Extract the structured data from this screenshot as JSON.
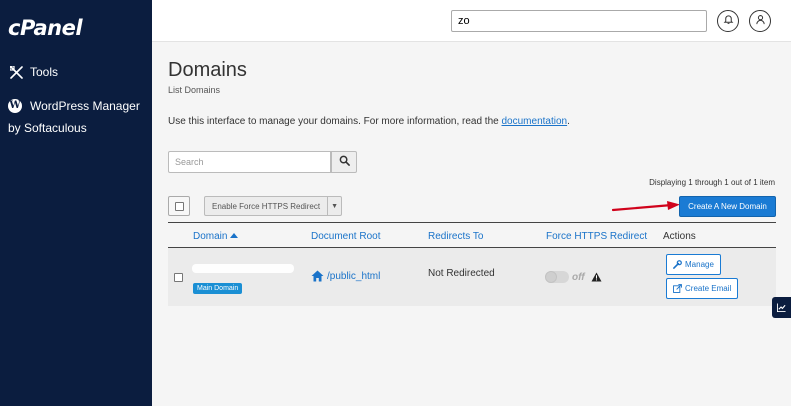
{
  "sidebar": {
    "logo": "cPanel",
    "items": [
      {
        "label": "Tools",
        "icon": "tools-icon"
      },
      {
        "label_line1": "WordPress Manager",
        "label_line2": "by Softaculous",
        "icon": "wordpress-icon"
      }
    ]
  },
  "topbar": {
    "search_value": "zo",
    "icons": [
      "bell-icon",
      "user-icon"
    ]
  },
  "page": {
    "title": "Domains",
    "subtitle": "List Domains",
    "intro_text": "Use this interface to manage your domains. For more information, read the ",
    "intro_link": "documentation",
    "intro_end": "."
  },
  "toolbar": {
    "search_placeholder": "Search",
    "displaying": "Displaying 1 through 1 out of 1 item",
    "force_https_button": "Enable Force HTTPS Redirect",
    "create_button": "Create A New Domain"
  },
  "table": {
    "headers": {
      "domain": "Domain",
      "document_root": "Document Root",
      "redirects_to": "Redirects To",
      "force_https": "Force HTTPS Redirect",
      "actions": "Actions"
    },
    "rows": [
      {
        "badge": "Main Domain",
        "document_root": "/public_html",
        "redirects_to": "Not Redirected",
        "force_https_state": "off",
        "actions": {
          "manage": "Manage",
          "create_email": "Create Email"
        }
      }
    ]
  },
  "colors": {
    "sidebar_bg": "#0b1d3f",
    "accent": "#1a7bd4",
    "link": "#1a73c9",
    "annotation_arrow": "#d0021b"
  }
}
